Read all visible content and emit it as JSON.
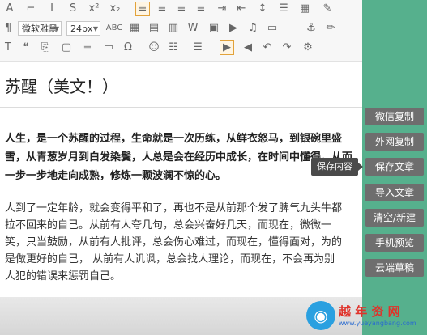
{
  "toolbar": {
    "font_family": "微软雅黑",
    "font_size": "24px",
    "icons_row1": [
      "font-color-icon",
      "highlight-icon",
      "italic-icon",
      "strikethrough-icon",
      "superscript-icon",
      "subscript-icon",
      "clear-format-icon",
      "format-painter-icon",
      "align-left-icon",
      "align-center-icon",
      "align-right-icon",
      "align-justify-icon",
      "indent-icon",
      "outdent-icon",
      "line-height-icon",
      "list-icon"
    ],
    "icons_row2": [
      "paragraph-icon",
      "font-family-icon",
      "font-size-icon",
      "case-icon",
      "table-icon",
      "insert-row-icon",
      "insert-col-icon",
      "merge-icon",
      "word-icon",
      "image-icon",
      "video-icon",
      "music-icon",
      "code-icon",
      "link-icon",
      "anchor-icon",
      "pen-icon"
    ],
    "icons_row3": [
      "text-icon",
      "quote-icon",
      "format-icon",
      "special-char-icon",
      "emoji-icon",
      "ordered-list-icon",
      "unordered-list-icon",
      "hr-icon",
      "ltr-icon",
      "rtl-icon",
      "undo-icon",
      "redo-icon",
      "source-icon"
    ]
  },
  "article": {
    "title": "苏醒（美文！）",
    "lead": "人生，是一个苏醒的过程，生命就是一次历练，从鲜衣怒马，到银碗里盛雪，从青葱岁月到白发染鬓，人总是会在经历中成长，在时间中懂得，从而一步一步地走向成熟，修炼一颗波澜不惊的心。",
    "body": "人到了一定年龄，就会变得平和了，再也不是从前那个发了脾气九头牛都拉不回来的自己。从前有人夸几句，总会兴奋好几天，而现在，微微一笑，只当鼓励，从前有人批评，总会伤心难过，而现在，懂得面对，为的是做更好的自己， 从前有人讥讽，总会找人理论，而现在，不会再为别人犯的错误来惩罚自己。"
  },
  "sidebar": {
    "buttons": [
      "微信复制",
      "外网复制",
      "保存文章",
      "导入文章",
      "清空/新建",
      "手机预览",
      "云端草稿"
    ]
  },
  "tooltip": "保存内容",
  "watermark": {
    "name": "越 年 资 网",
    "url": "www.yueyangbang.com"
  },
  "colors": {
    "sidebar_bg": "#56b08d",
    "button_bg": "#6e6e6e"
  }
}
